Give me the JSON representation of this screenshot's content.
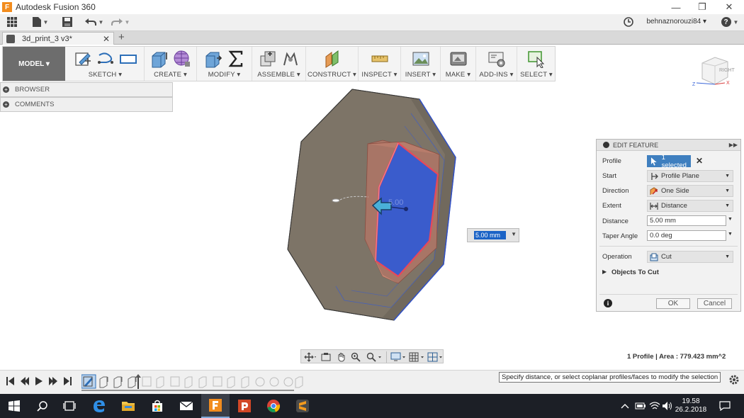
{
  "window": {
    "title": "Autodesk Fusion 360",
    "logo_letter": "F"
  },
  "quickaccess": {
    "user": "behnaznorouzi84 ▾",
    "help": "?"
  },
  "tabs": {
    "document": "3d_print_3 v3*",
    "close": "✕",
    "new": "+"
  },
  "ribbon": {
    "workspace": "MODEL ▾",
    "groups": [
      "SKETCH ▾",
      "CREATE ▾",
      "MODIFY ▾",
      "ASSEMBLE ▾",
      "CONSTRUCT ▾",
      "INSPECT ▾",
      "INSERT ▾",
      "MAKE ▾",
      "ADD-INS ▾",
      "SELECT ▾"
    ]
  },
  "viewcube": {
    "face_label": "RIGHT",
    "x": "X",
    "z": "Z"
  },
  "browser": {
    "browser_label": "BROWSER",
    "comments_label": "COMMENTS"
  },
  "viewport": {
    "manipulator_value": "5.00",
    "distance_input": "5.00 mm"
  },
  "dialog": {
    "title": "EDIT FEATURE",
    "profile_label": "Profile",
    "profile_value": "1 selected",
    "start_label": "Start",
    "start_value": "Profile Plane",
    "direction_label": "Direction",
    "direction_value": "One Side",
    "extent_label": "Extent",
    "extent_value": "Distance",
    "distance_label": "Distance",
    "distance_value": "5.00 mm",
    "taper_label": "Taper Angle",
    "taper_value": "0.0 deg",
    "operation_label": "Operation",
    "operation_value": "Cut",
    "objects_label": "Objects To Cut",
    "ok": "OK",
    "cancel": "Cancel",
    "info": "i"
  },
  "status": {
    "profile_area": "1 Profile | Area : 779.423 mm^2",
    "tooltip": "Specify distance, or select coplanar profiles/faces to modify the selection"
  },
  "taskbar": {
    "time": "19.58",
    "date": "26.2.2018"
  },
  "colors": {
    "cut_blue": "#3a5ccc",
    "profile_red": "#e8485a",
    "body_brown": "#7d7467",
    "ribbon_workspace": "#6d6d6d",
    "selection_blue": "#3f7fbf",
    "taskbar": "#1c1f26"
  }
}
